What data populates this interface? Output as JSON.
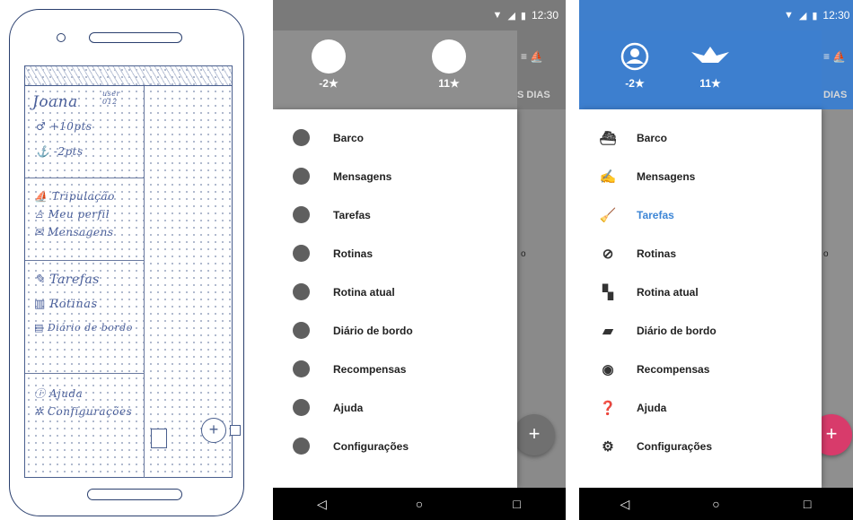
{
  "sketch": {
    "user_name": "Joana",
    "user_note": "user 012",
    "points_up": "+10pts",
    "points_down": "-2pts",
    "items": [
      "Tripulação",
      "Meu perfil",
      "Mensagens",
      "Tarefas",
      "Rotinas",
      "Diário de bordo",
      "Ajuda",
      "Configurações"
    ],
    "fab": "+"
  },
  "status_bar": {
    "time": "12:30",
    "wifi_icon": "wifi-icon",
    "signal_icon": "signal-icon",
    "battery_icon": "battery-icon"
  },
  "header": {
    "score_left": "-2★",
    "score_right": "11★"
  },
  "behind": {
    "tab_text": "DIAS",
    "tab_text_gray": "S DIAS",
    "char_o": "o"
  },
  "menu": [
    {
      "label": "Barco",
      "icon": "boat-icon"
    },
    {
      "label": "Mensagens",
      "icon": "messages-icon"
    },
    {
      "label": "Tarefas",
      "icon": "broom-icon"
    },
    {
      "label": "Rotinas",
      "icon": "compass-icon"
    },
    {
      "label": "Rotina atual",
      "icon": "map-icon"
    },
    {
      "label": "Diário de bordo",
      "icon": "logbook-icon"
    },
    {
      "label": "Recompensas",
      "icon": "rewards-icon"
    },
    {
      "label": "Ajuda",
      "icon": "help-icon"
    },
    {
      "label": "Configurações",
      "icon": "gear-icon"
    }
  ],
  "active_item_colored": "Tarefas",
  "fab_label": "+",
  "nav": {
    "back": "◁",
    "home": "○",
    "recents": "□"
  },
  "colors": {
    "gray_app_bar": "#7a7a7a",
    "gray_drawer_header": "#8e8e8e",
    "blue_header": "#3d7fcf",
    "active_blue": "#3d86d6",
    "fab_pink": "#d83b6b",
    "fab_gray": "#707070"
  }
}
